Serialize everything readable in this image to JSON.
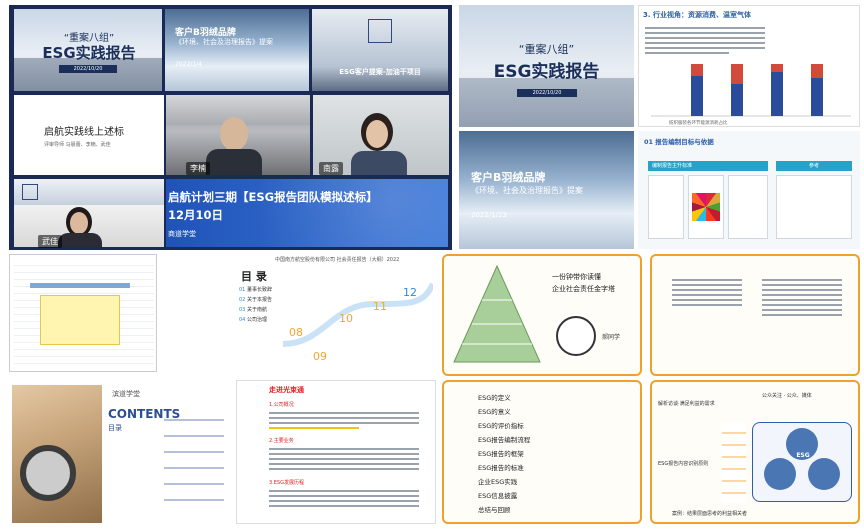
{
  "vc": {
    "slide1": {
      "subtitle": "“重案八组”",
      "title": "ESG实践报告",
      "date": "2022/10/20"
    },
    "slide2": {
      "title": "客户B羽绒品牌",
      "subtitle": "《环境、社会及治理报告》提案",
      "date": "2022/1/4"
    },
    "slide3": {
      "title": "ESG客户提案-加油干项目"
    },
    "slide4": {
      "title": "启航实践线上述标",
      "meta": "评审导师 马晨蕾、李楠、武佳"
    },
    "person1": {
      "name": "李楠"
    },
    "person2": {
      "name": "南露"
    },
    "person3": {
      "name": "武佳"
    },
    "banner": {
      "title": "启航计划三期【ESG报告团队模拟述标】",
      "date": "12月10日",
      "brand": "商道学堂"
    }
  },
  "tr1": {
    "subtitle": "“重案八组”",
    "title": "ESG实践报告",
    "date": "2022/10/20"
  },
  "tr2": {
    "heading": "3. 行业视角：资源消费、温室气体",
    "chart_label": "纺织服装各环节能源消耗占比"
  },
  "tr3": {
    "title": "客户B羽绒品牌",
    "subtitle": "《环境、社会及治理报告》提案",
    "date": "2022/1/23"
  },
  "tr4": {
    "heading": "01 报告编制目标与依据",
    "left": "编制报告主升标准",
    "right": "参考"
  },
  "m1": {
    "header": "中国南方航空股份有限公司 社会责任报告（大纲）2022"
  },
  "m2": {
    "title": "目 录",
    "items": [
      {
        "no": "01",
        "label": "董事长致辞"
      },
      {
        "no": "02",
        "label": "关于本报告"
      },
      {
        "no": "03",
        "label": "关于南航"
      },
      {
        "no": "04",
        "label": "公司治理"
      }
    ],
    "nodes": [
      "08",
      "10",
      "11",
      "12",
      "09"
    ]
  },
  "m3": {
    "top_lines": [
      "一份钟带你读懂",
      "企业社会责任金字塔"
    ],
    "label": "郝同学"
  },
  "m4": {
    "lines": [
      "ESG基本概念",
      "ESG发展历程",
      "ESG评级体系",
      "ESG报告框架"
    ]
  },
  "b1": {
    "brand": "滨道学堂",
    "title": "CONTENTS",
    "subtitle": "目录"
  },
  "b2": {
    "heading": "走进光束通",
    "lines": [
      "1.公司概况",
      "2.主要业务",
      "3.ESG发展历程"
    ]
  },
  "b3": {
    "items": [
      "ESG的定义",
      "ESG的意义",
      "ESG的评价指标",
      "ESG报告编制流程",
      "ESG报告的框架",
      "ESG报告的标准",
      "企业ESG实践",
      "ESG信息披露",
      "总结与回顾"
    ]
  },
  "b4": {
    "center": "ESG",
    "left_top": "解析访谈·满足利益的需求",
    "left_mid": "ESG报告内容识别原则",
    "right_top": "公众关注 · 公众、媒体",
    "bottom": "案例：结果层面思考的利益相关者"
  }
}
